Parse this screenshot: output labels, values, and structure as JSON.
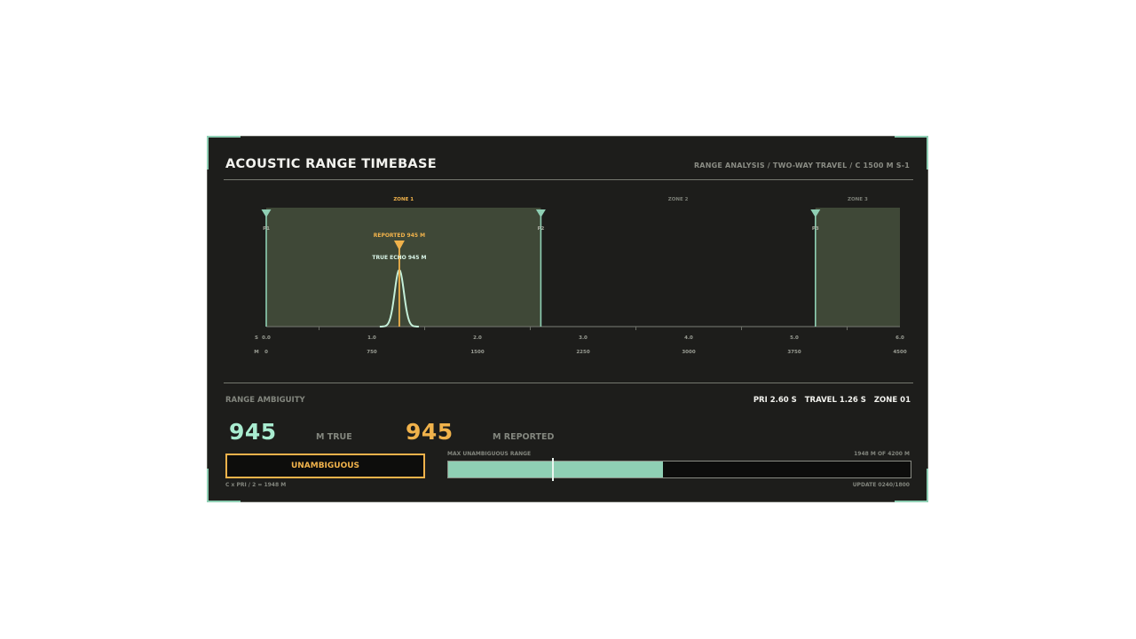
{
  "header": {
    "title": "ACOUSTIC RANGE TIMEBASE",
    "subtitle": "RANGE ANALYSIS / TWO-WAY TRAVEL / C 1500 M S-1"
  },
  "timebase": {
    "zones": [
      {
        "label": "ZONE 1",
        "active": true
      },
      {
        "label": "ZONE 2",
        "active": false
      },
      {
        "label": "ZONE 3",
        "active": false
      }
    ],
    "pulses": [
      {
        "label": "P1",
        "time_s": 0.0
      },
      {
        "label": "P2",
        "time_s": 2.6
      },
      {
        "label": "P3",
        "time_s": 5.2
      }
    ],
    "shaded_zones": [
      [
        0.0,
        2.6
      ],
      [
        5.2,
        6.0
      ]
    ],
    "reported_label": "REPORTED 945 M",
    "true_echo_label": "TRUE ECHO 945 M",
    "echo_time_s": 1.26,
    "time_axis_unit": "S",
    "range_axis_unit": "M",
    "time_ticks": [
      "0.0",
      "1.0",
      "2.0",
      "3.0",
      "4.0",
      "5.0",
      "6.0"
    ],
    "range_ticks": [
      "0",
      "750",
      "1500",
      "2250",
      "3000",
      "3750",
      "4500"
    ],
    "time_max": 6.0,
    "colors": {
      "accent_green": "#8fcfb4",
      "accent_orange": "#f0b24b",
      "zone_fill": "#3f4837"
    }
  },
  "ambiguity": {
    "label": "RANGE AMBIGUITY",
    "pri": "PRI 2.60 S",
    "travel": "TRAVEL 1.26 S",
    "zone": "ZONE 01",
    "true_value": "945",
    "true_unit": "M TRUE",
    "reported_value": "945",
    "reported_unit": "M REPORTED",
    "status": "UNAMBIGUOUS",
    "formula": "C x PRI / 2 = 1948 M",
    "bar_label": "MAX UNAMBIGUOUS RANGE",
    "bar_value": "1948 M OF 4200 M",
    "bar_fraction": 0.4638,
    "marker_fraction": 0.225,
    "update": "UPDATE 0240/1800"
  }
}
